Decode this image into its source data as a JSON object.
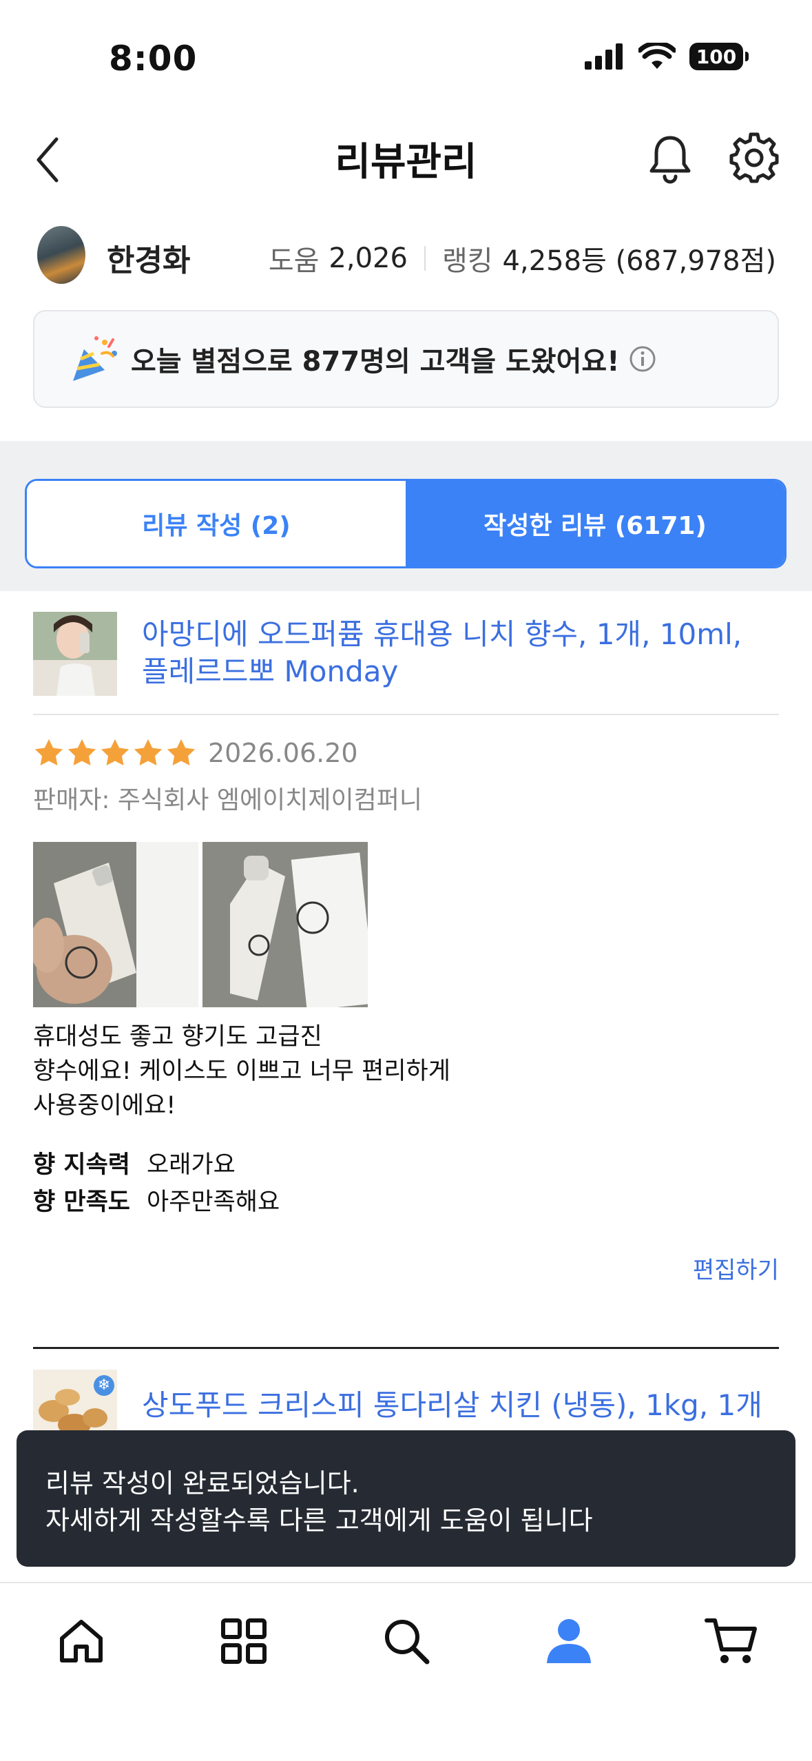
{
  "status_bar": {
    "time": "8:00",
    "battery": "100"
  },
  "header": {
    "title": "리뷰관리"
  },
  "profile": {
    "name": "한경화",
    "help_label": "도움",
    "help_value": "2,026",
    "rank_label": "랭킹",
    "rank_value": "4,258등 (687,978점)"
  },
  "banner": {
    "text": "오늘 별점으로 877명의 고객을 도왔어요!"
  },
  "tabs": [
    {
      "label": "리뷰 작성 (2)",
      "active": false
    },
    {
      "label": "작성한 리뷰 (6171)",
      "active": true
    }
  ],
  "review": {
    "product_title": "아망디에 오드퍼퓸 휴대용 니치 향수, 1개, 10ml, 플레르드뽀 Monday",
    "rating": 5,
    "date": "2026.06.20",
    "seller": "판매자: 주식회사 엠에이치제이컴퍼니",
    "body_lines": [
      "휴대성도 좋고 향기도 고급진",
      "향수에요! 케이스도 이쁘고 너무 편리하게",
      "사용중이에요!"
    ],
    "attributes": [
      {
        "key": "향 지속력",
        "value": "오래가요"
      },
      {
        "key": "향 만족도",
        "value": "아주만족해요"
      }
    ],
    "edit_label": "편집하기"
  },
  "review2": {
    "product_title": "상도푸드 크리스피 통다리살 치킨 (냉동), 1kg, 1개"
  },
  "toast": {
    "line1": "리뷰 작성이 완료되었습니다.",
    "line2": "자세하게 작성할수록 다른 고객에게 도움이 됩니다"
  },
  "bottom_nav": [
    "home-icon",
    "categories-icon",
    "search-icon",
    "profile-icon",
    "cart-icon"
  ],
  "colors": {
    "accent": "#3b82f6",
    "star": "#f5a13a",
    "link": "#3b6fe0",
    "toast_bg": "#262b33"
  }
}
